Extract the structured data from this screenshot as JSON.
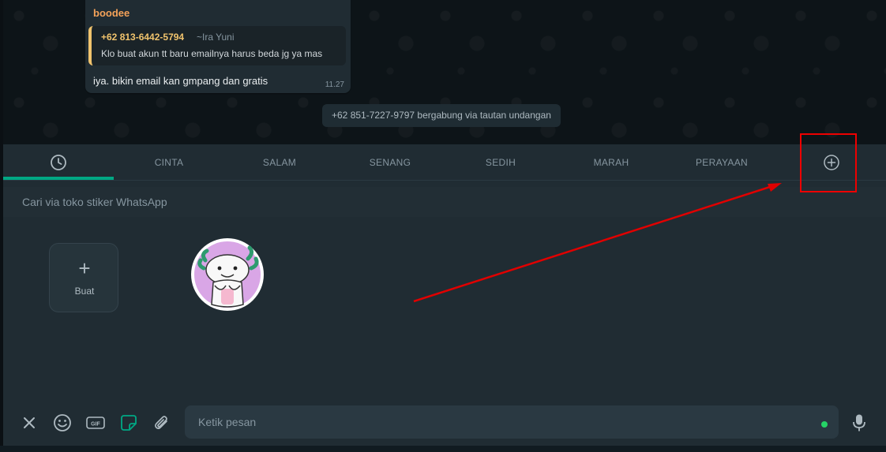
{
  "message": {
    "sender": "boodee",
    "quote_sender": "+62 813-6442-5794",
    "quote_name": "~Ira Yuni",
    "quote_text": "Klo buat akun tt baru emailnya harus beda jg ya mas",
    "text": "iya. bikin email kan gmpang dan gratis",
    "time": "11.27"
  },
  "system_note": "+62 851-7227-9797 bergabung via tautan undangan",
  "sticker_panel": {
    "tabs": [
      {
        "label": "",
        "icon": "recent-clock-icon",
        "active": true
      },
      {
        "label": "CINTA"
      },
      {
        "label": "SALAM"
      },
      {
        "label": "SENANG"
      },
      {
        "label": "SEDIH"
      },
      {
        "label": "MARAH"
      },
      {
        "label": "PERAYAAN"
      },
      {
        "label": "",
        "icon": "add-circle-icon"
      }
    ],
    "search_placeholder": "Cari via toko stiker WhatsApp",
    "create_label": "Buat",
    "create_icon": "plus",
    "stickers": [
      {
        "icon": "axolotl-sticker"
      }
    ]
  },
  "compose": {
    "placeholder": "Ketik pesan",
    "icons": [
      "close-icon",
      "emoji-icon",
      "gif-icon",
      "sticker-icon",
      "attach-icon",
      "mic-icon"
    ]
  },
  "colors": {
    "accent": "#00a884",
    "annotation": "#e00000",
    "sender": "#f4a259",
    "quote": "#f0c36d"
  }
}
